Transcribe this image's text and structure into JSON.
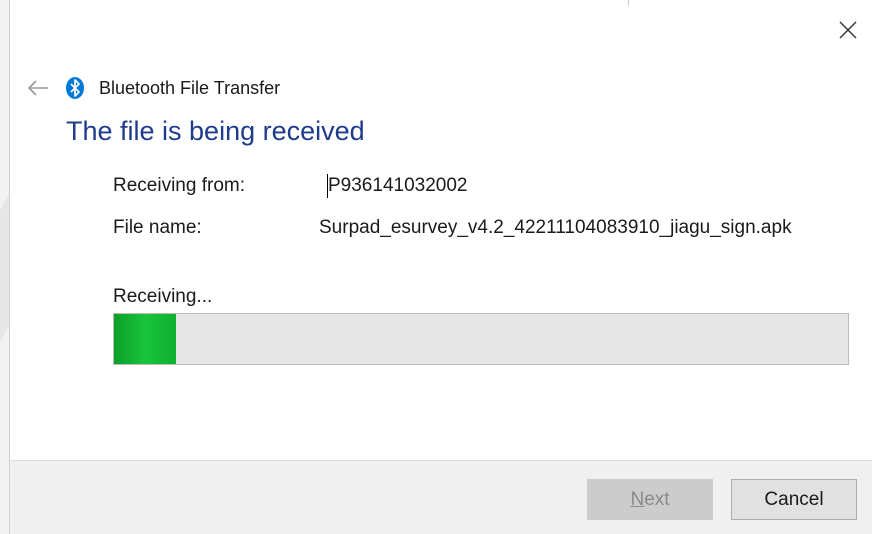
{
  "window": {
    "app_title": "Bluetooth File Transfer",
    "close_icon": "close-icon",
    "back_icon": "back-arrow-icon",
    "app_icon": "bluetooth-icon"
  },
  "main": {
    "heading": "The file is being received",
    "receiving_from_label": "Receiving from:",
    "receiving_from_value": "P936141032002",
    "file_name_label": "File name:",
    "file_name_value": "Surpad_esurvey_v4.2_42211104083910_jiagu_sign.apk",
    "progress_label": "Receiving...",
    "progress_fraction": 0.085
  },
  "footer": {
    "next_label_accel": "N",
    "next_label_rest": "ext",
    "next_enabled": false,
    "cancel_label": "Cancel"
  },
  "colors": {
    "heading": "#1f3c8c",
    "progress_fill": "#18c43b",
    "progress_track": "#e6e6e6",
    "bluetooth_badge": "#0078d7"
  }
}
